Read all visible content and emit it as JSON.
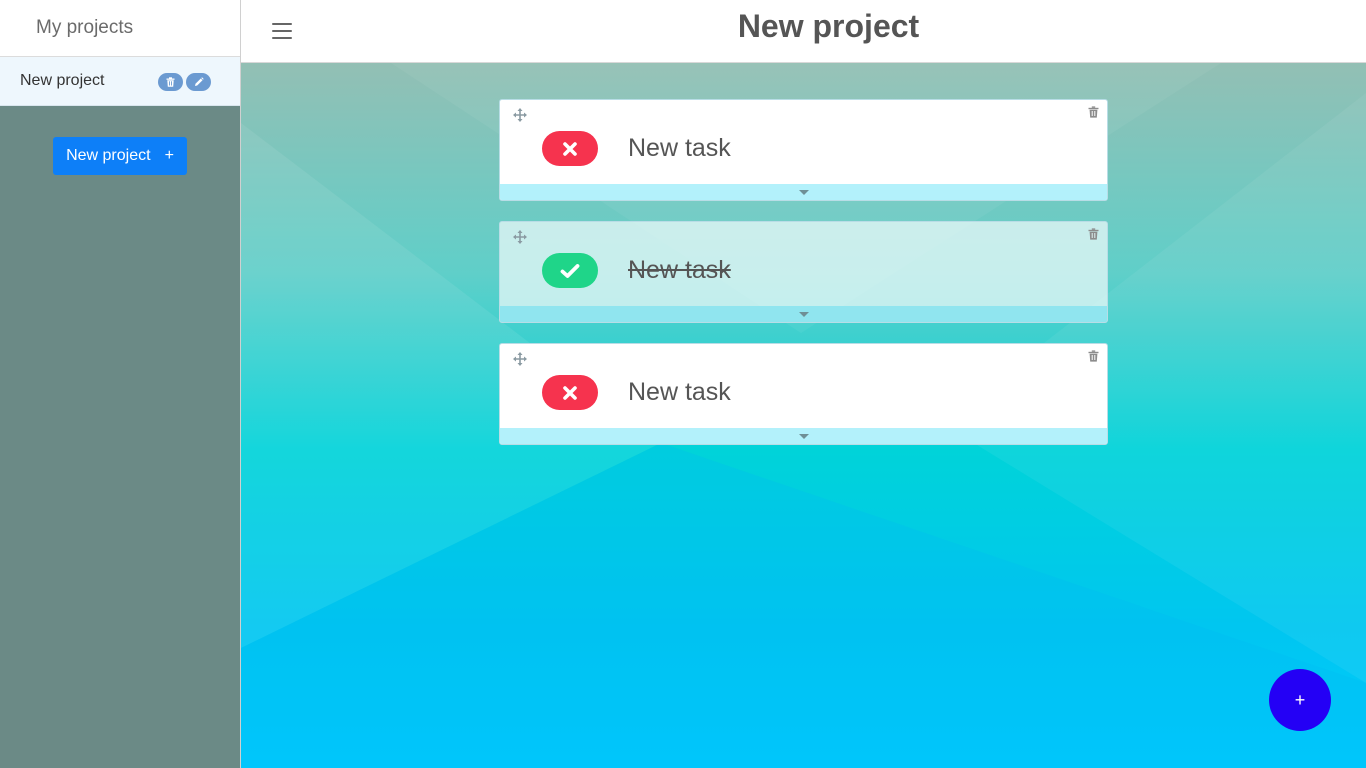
{
  "sidebar": {
    "title": "My projects",
    "projects": [
      {
        "name": "New project"
      }
    ],
    "new_project_label": "New project",
    "new_project_icon": "+"
  },
  "header": {
    "title": "New project"
  },
  "tasks": [
    {
      "title": "New task",
      "done": false
    },
    {
      "title": "New task",
      "done": true
    },
    {
      "title": "New task",
      "done": false
    }
  ],
  "fab": {
    "label": "+"
  },
  "colors": {
    "pending": "#f6334e",
    "complete": "#1fd589",
    "accent": "#0d7ff8",
    "fab": "#2400f5"
  }
}
